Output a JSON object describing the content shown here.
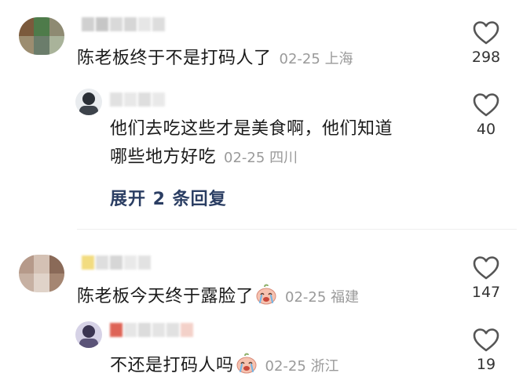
{
  "comments": [
    {
      "text": "陈老板终于不是打码人了",
      "date": "02-25",
      "location": "上海",
      "likes": "298",
      "reply": {
        "text_line1": "他们去吃这些才是美食啊，他们知道",
        "text_line2": "哪些地方好吃",
        "date": "02-25",
        "location": "四川",
        "likes": "40"
      },
      "expand_label": "展开 2 条回复"
    },
    {
      "text": "陈老板今天终于露脸了",
      "date": "02-25",
      "location": "福建",
      "likes": "147",
      "reply": {
        "text": "不还是打码人吗",
        "date": "02-25",
        "location": "浙江",
        "likes": "19"
      }
    }
  ],
  "icons": {
    "like": "heart-outline-icon",
    "emoji": "crying-face-emoji"
  },
  "colors": {
    "expand_link": "#2b3e63",
    "meta_text": "#9a9a9a"
  }
}
